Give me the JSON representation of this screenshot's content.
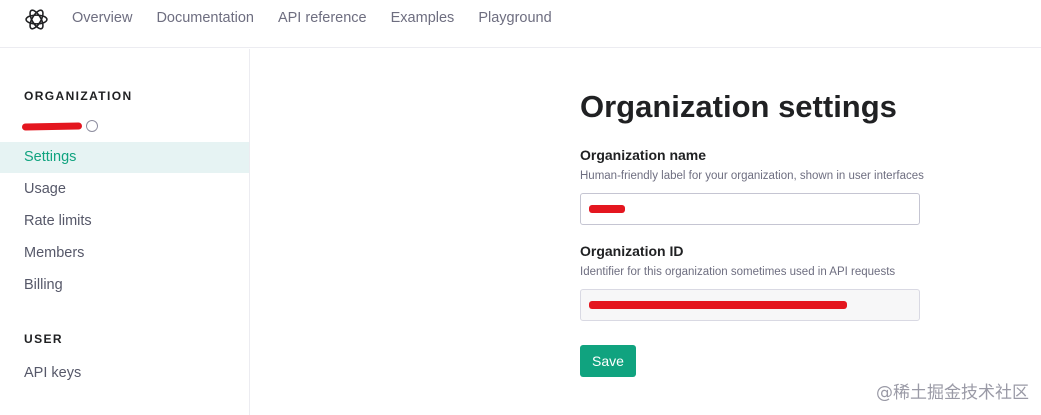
{
  "app": {
    "logo_icon": "openai-logo-icon"
  },
  "nav": {
    "items": [
      {
        "label": "Overview"
      },
      {
        "label": "Documentation"
      },
      {
        "label": "API reference"
      },
      {
        "label": "Examples"
      },
      {
        "label": "Playground"
      }
    ]
  },
  "sidebar": {
    "organization_title": "ORGANIZATION",
    "organization_items": [
      {
        "label": "Settings",
        "active": true
      },
      {
        "label": "Usage"
      },
      {
        "label": "Rate limits"
      },
      {
        "label": "Members"
      },
      {
        "label": "Billing"
      }
    ],
    "user_title": "USER",
    "user_items": [
      {
        "label": "API keys"
      }
    ]
  },
  "main": {
    "title": "Organization settings",
    "org_name": {
      "label": "Organization name",
      "help": "Human-friendly label for your organization, shown in user interfaces"
    },
    "org_id": {
      "label": "Organization ID",
      "help": "Identifier for this organization sometimes used in API requests"
    },
    "save_label": "Save"
  },
  "watermark": "@稀土掘金技术社区",
  "colors": {
    "accent": "#10a37f",
    "active_bg": "#e6f3f3",
    "redaction": "#e4161f"
  }
}
